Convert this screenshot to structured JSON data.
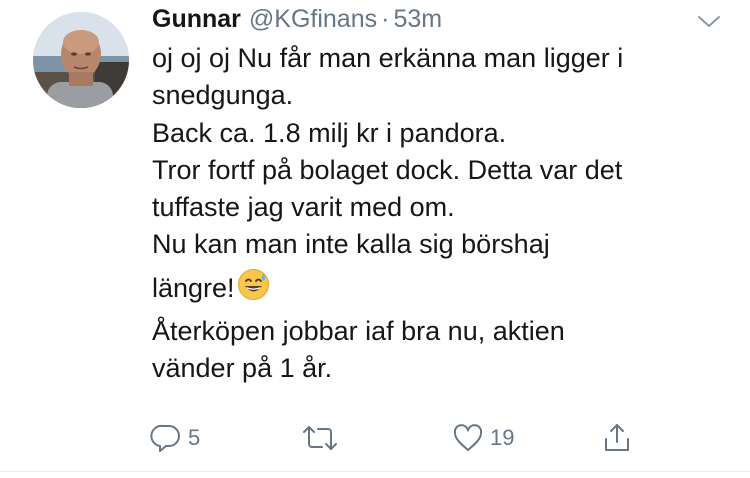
{
  "tweet": {
    "author": {
      "display_name": "Gunnar",
      "handle": "@KGfinans",
      "avatar_icon": "profile-photo"
    },
    "separator": "·",
    "timestamp": "53m",
    "menu_icon": "chevron-down-icon",
    "body_lines": [
      "oj oj oj Nu får man erkänna man ligger i",
      "snedgunga.",
      "Back ca. 1.8 milj kr i pandora.",
      "Tror fortf på bolaget dock. Detta var det",
      "tuffaste jag varit med om.",
      "Nu kan man inte kalla sig börshaj",
      "längre!",
      "Återköpen jobbar iaf bra nu, aktien",
      "vänder på 1 år."
    ],
    "emoji": "grinning-face-with-sweat",
    "actions": {
      "reply": {
        "icon": "reply-icon",
        "count": "5"
      },
      "retweet": {
        "icon": "retweet-icon",
        "count": ""
      },
      "like": {
        "icon": "heart-icon",
        "count": "19"
      },
      "share": {
        "icon": "share-icon",
        "count": ""
      }
    },
    "colors": {
      "text": "#14171a",
      "secondary": "#657786",
      "divider": "#e6ecf0"
    }
  }
}
